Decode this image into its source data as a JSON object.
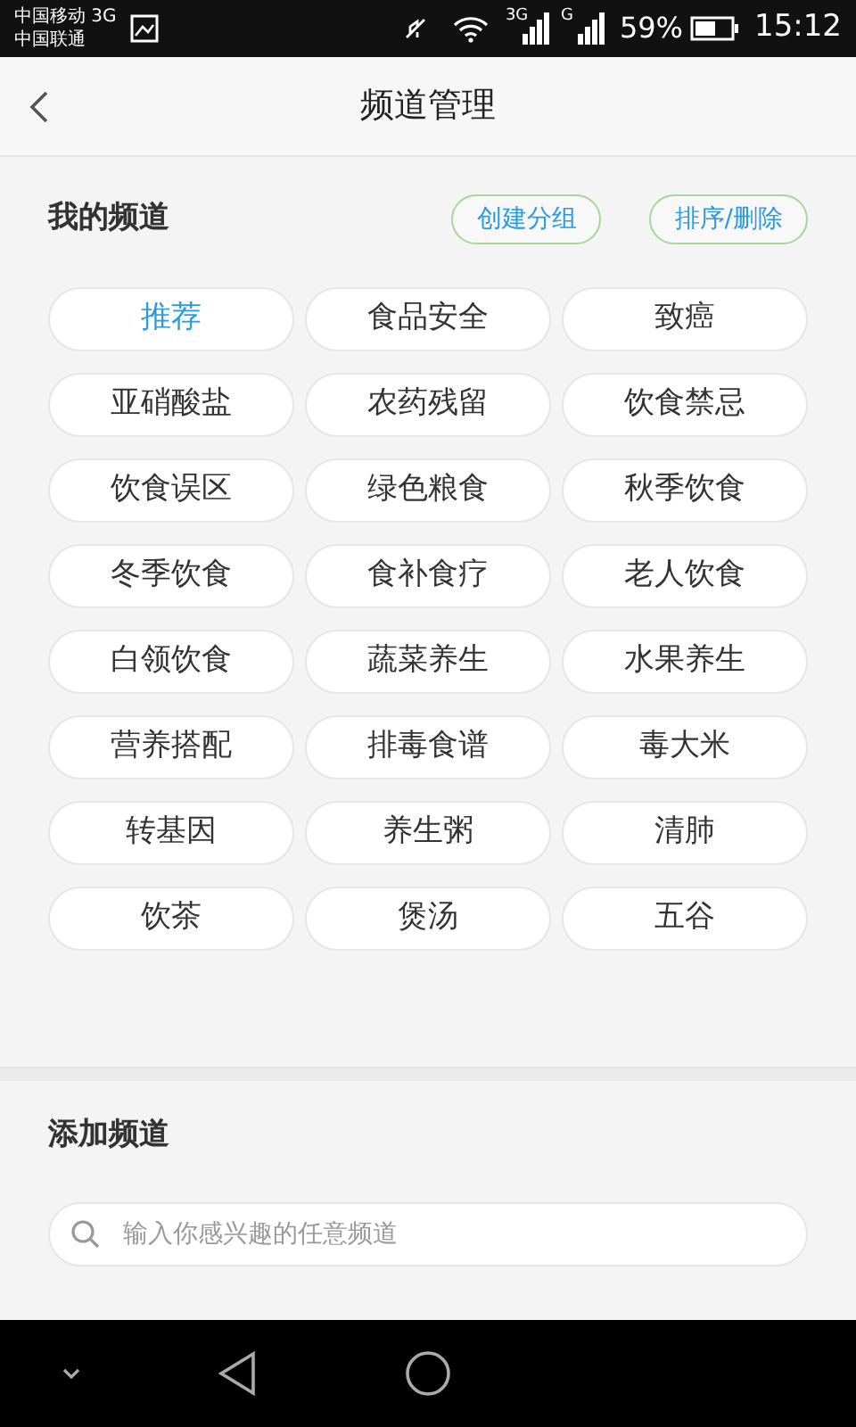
{
  "status_bar": {
    "carriers": [
      "中国移动 3G",
      "中国联通"
    ],
    "network_labels": [
      "3G",
      "G"
    ],
    "battery": "59%",
    "time": "15:12"
  },
  "header": {
    "title": "频道管理"
  },
  "my_channels": {
    "title": "我的频道",
    "buttons": [
      "创建分组",
      "排序/删除"
    ],
    "channels": [
      {
        "label": "推荐",
        "selected": true
      },
      {
        "label": "食品安全",
        "selected": false
      },
      {
        "label": "致癌",
        "selected": false
      },
      {
        "label": "亚硝酸盐",
        "selected": false
      },
      {
        "label": "农药残留",
        "selected": false
      },
      {
        "label": "饮食禁忌",
        "selected": false
      },
      {
        "label": "饮食误区",
        "selected": false
      },
      {
        "label": "绿色粮食",
        "selected": false
      },
      {
        "label": "秋季饮食",
        "selected": false
      },
      {
        "label": "冬季饮食",
        "selected": false
      },
      {
        "label": "食补食疗",
        "selected": false
      },
      {
        "label": "老人饮食",
        "selected": false
      },
      {
        "label": "白领饮食",
        "selected": false
      },
      {
        "label": "蔬菜养生",
        "selected": false
      },
      {
        "label": "水果养生",
        "selected": false
      },
      {
        "label": "营养搭配",
        "selected": false
      },
      {
        "label": "排毒食谱",
        "selected": false
      },
      {
        "label": "毒大米",
        "selected": false
      },
      {
        "label": "转基因",
        "selected": false
      },
      {
        "label": "养生粥",
        "selected": false
      },
      {
        "label": "清肺",
        "selected": false
      },
      {
        "label": "饮茶",
        "selected": false
      },
      {
        "label": "煲汤",
        "selected": false
      },
      {
        "label": "五谷",
        "selected": false
      }
    ]
  },
  "add_channel": {
    "title": "添加频道",
    "search": {
      "placeholder": "输入你感兴趣的任意频道"
    }
  }
}
